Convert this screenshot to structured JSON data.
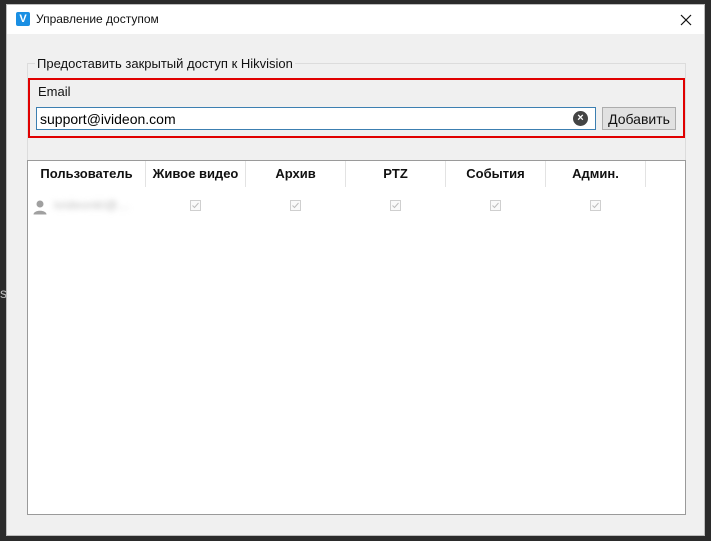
{
  "background": {
    "partial_text": "s"
  },
  "window": {
    "title": "Управление доступом",
    "app_icon_letter": "V",
    "close_symbol": "×"
  },
  "form": {
    "group_title": "Предоставить закрытый доступ к Hikvision",
    "email_label": "Email",
    "email_value": "support@ivideon.com",
    "clear_symbol": "×",
    "add_button": "Добавить"
  },
  "table": {
    "columns": [
      "Пользователь",
      "Живое видео",
      "Архив",
      "PTZ",
      "События",
      "Админ."
    ],
    "rows": [
      {
        "user": "ivideonkl@...",
        "live_video": true,
        "archive": true,
        "ptz": true,
        "events": true,
        "admin": true
      }
    ]
  },
  "colors": {
    "highlight": "#e00000",
    "accent": "#1a8fe3"
  }
}
